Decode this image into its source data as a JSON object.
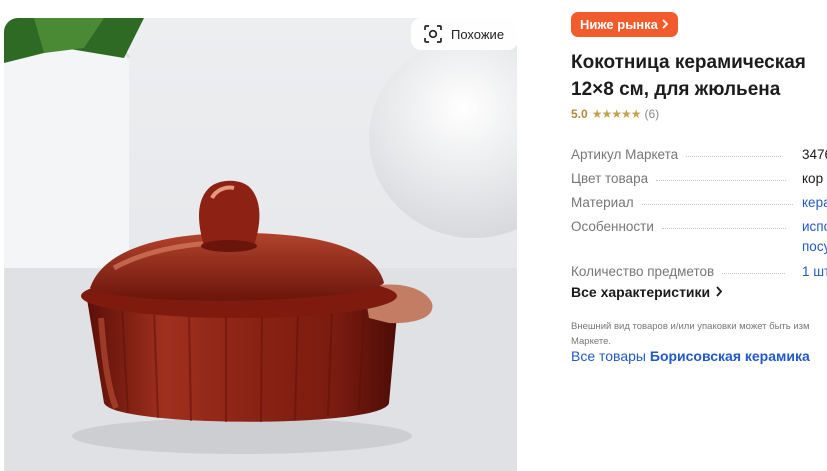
{
  "gallery": {
    "similar_label": "Похожие",
    "similar_icon": "visual-search-icon"
  },
  "product": {
    "badge_label": "Ниже рынка",
    "title_line1": "Кокотница керамическая",
    "title_line2": "12×8 см, для жюльена",
    "rating_value": "5.0",
    "rating_stars": "★★★★★",
    "rating_count": "(6)",
    "specs": [
      {
        "key": "Артикул Маркета",
        "value": "3476"
      },
      {
        "key": "Цвет товара",
        "value": "кор"
      },
      {
        "key": "Материал",
        "value": "кера"
      },
      {
        "key": "Особенности",
        "value": "испо",
        "value2": "посу"
      },
      {
        "key": "Количество предметов",
        "value": "1 шт"
      }
    ],
    "all_specs_label": "Все характеристики",
    "disclaimer_line1": "Внешний вид товаров и/или упаковки может быть изм",
    "disclaimer_line2": "Маркете.",
    "all_goods_prefix": "Все товары",
    "brand": "Борисовская керамика"
  },
  "colors": {
    "badge": "#f25c2d",
    "link": "#2159c9",
    "rating": "#c6a24e",
    "pot": "#8f1f12"
  }
}
